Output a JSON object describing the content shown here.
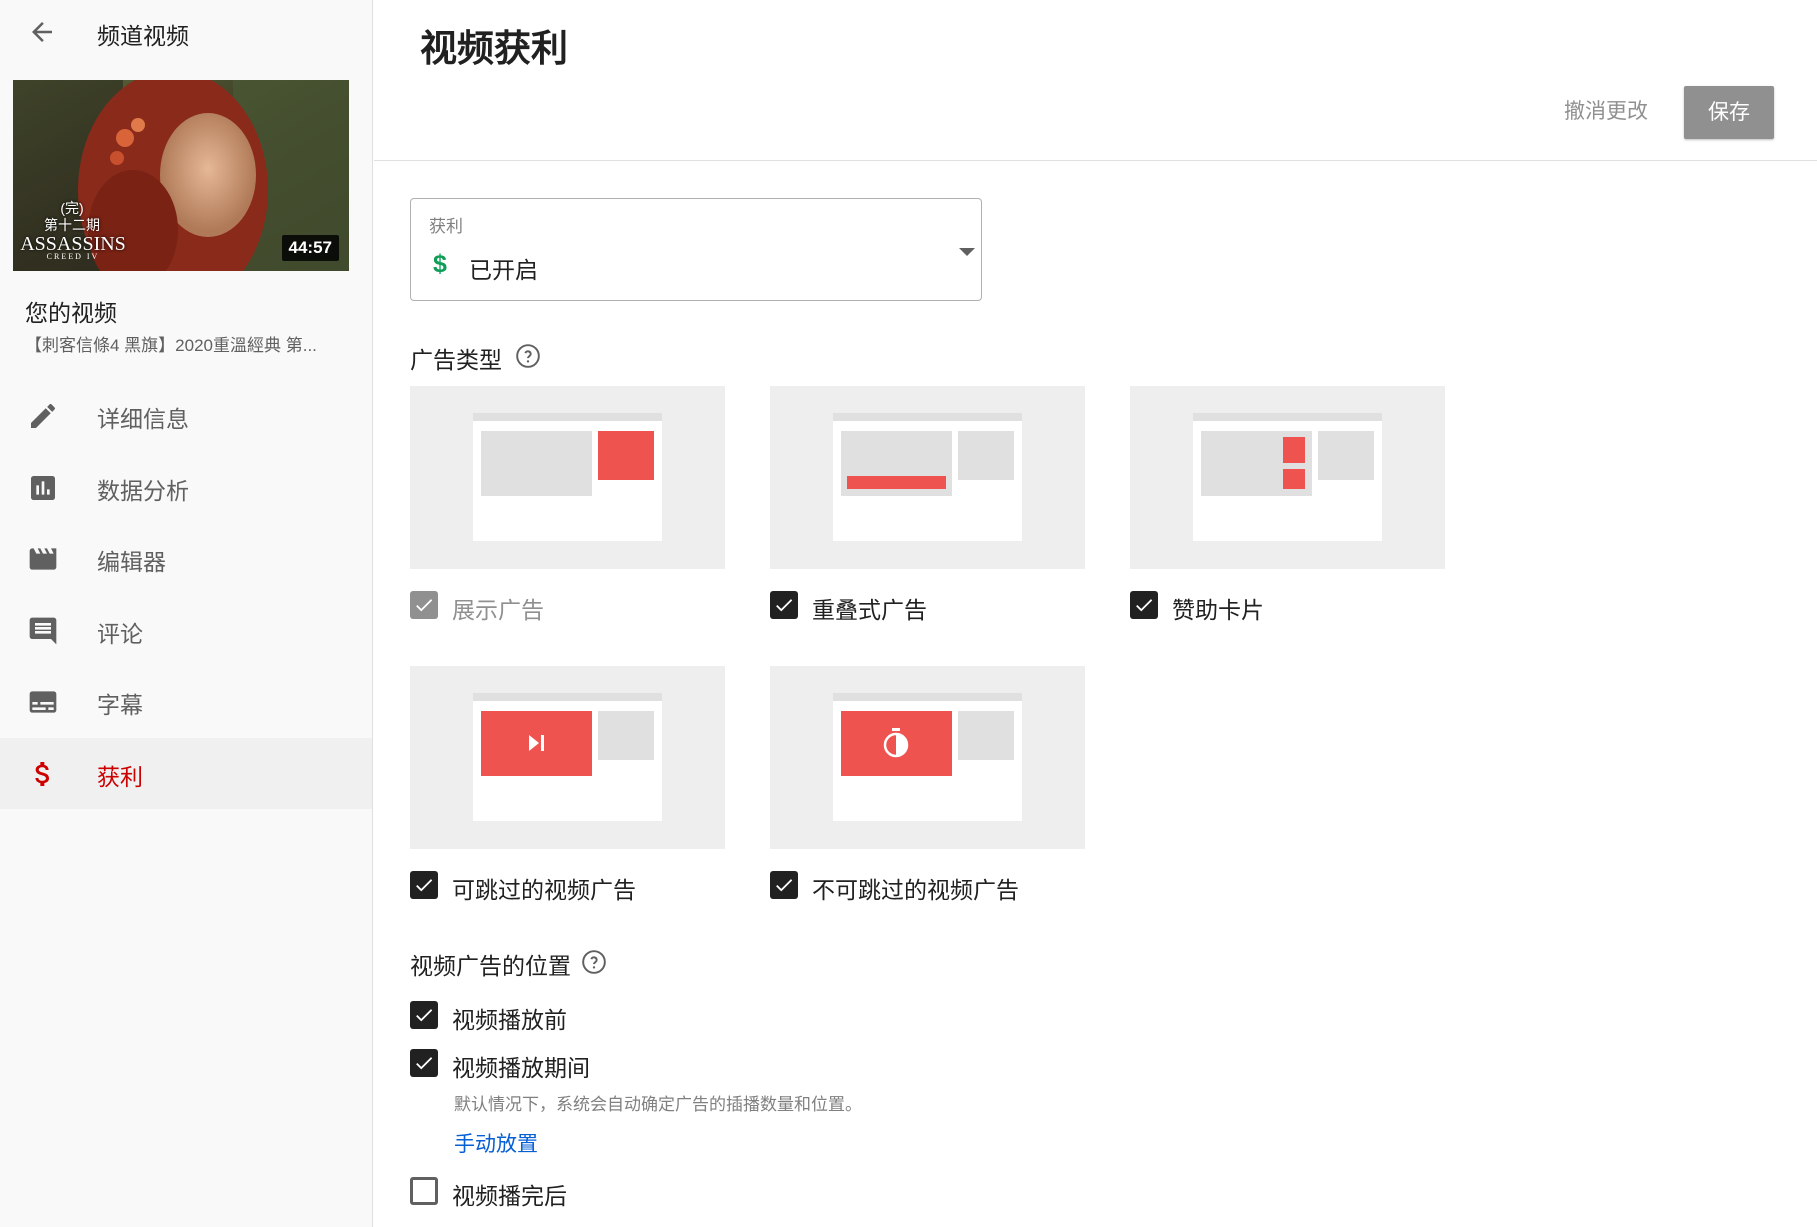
{
  "sidebar": {
    "back_title": "频道视频",
    "thumbnail": {
      "episode_line1": "(完)",
      "episode_line2": "第十二期",
      "logo": "ASSASSINS",
      "logo_sub": "CREED IV",
      "duration": "44:57"
    },
    "your_video_label": "您的视频",
    "video_title": "【刺客信條4 黑旗】2020重溫經典 第...",
    "nav": [
      {
        "label": "详细信息",
        "icon": "pencil-icon"
      },
      {
        "label": "数据分析",
        "icon": "analytics-icon"
      },
      {
        "label": "编辑器",
        "icon": "clapperboard-icon"
      },
      {
        "label": "评论",
        "icon": "comment-icon"
      },
      {
        "label": "字幕",
        "icon": "subtitles-icon"
      },
      {
        "label": "获利",
        "icon": "dollar-icon",
        "active": true
      }
    ]
  },
  "header": {
    "title": "视频获利",
    "undo_label": "撤消更改",
    "save_label": "保存"
  },
  "monetization_select": {
    "label": "获利",
    "value": "已开启",
    "symbol": "$"
  },
  "ad_types": {
    "title": "广告类型",
    "items": [
      {
        "label": "展示广告",
        "checked": true,
        "disabled": true
      },
      {
        "label": "重叠式广告",
        "checked": true,
        "disabled": false
      },
      {
        "label": "赞助卡片",
        "checked": true,
        "disabled": false
      },
      {
        "label": "可跳过的视频广告",
        "checked": true,
        "disabled": false
      },
      {
        "label": "不可跳过的视频广告",
        "checked": true,
        "disabled": false
      }
    ]
  },
  "ad_placement": {
    "title": "视频广告的位置",
    "items": [
      {
        "label": "视频播放前",
        "checked": true
      },
      {
        "label": "视频播放期间",
        "checked": true
      },
      {
        "label": "视频播完后",
        "checked": false
      }
    ],
    "hint": "默认情况下，系统会自动确定广告的插播数量和位置。",
    "manual_link": "手动放置"
  },
  "colors": {
    "accent_red": "#ef5350",
    "active_nav": "#cc0000",
    "link_blue": "#065fd4",
    "dollar_green": "#0f9d58"
  }
}
